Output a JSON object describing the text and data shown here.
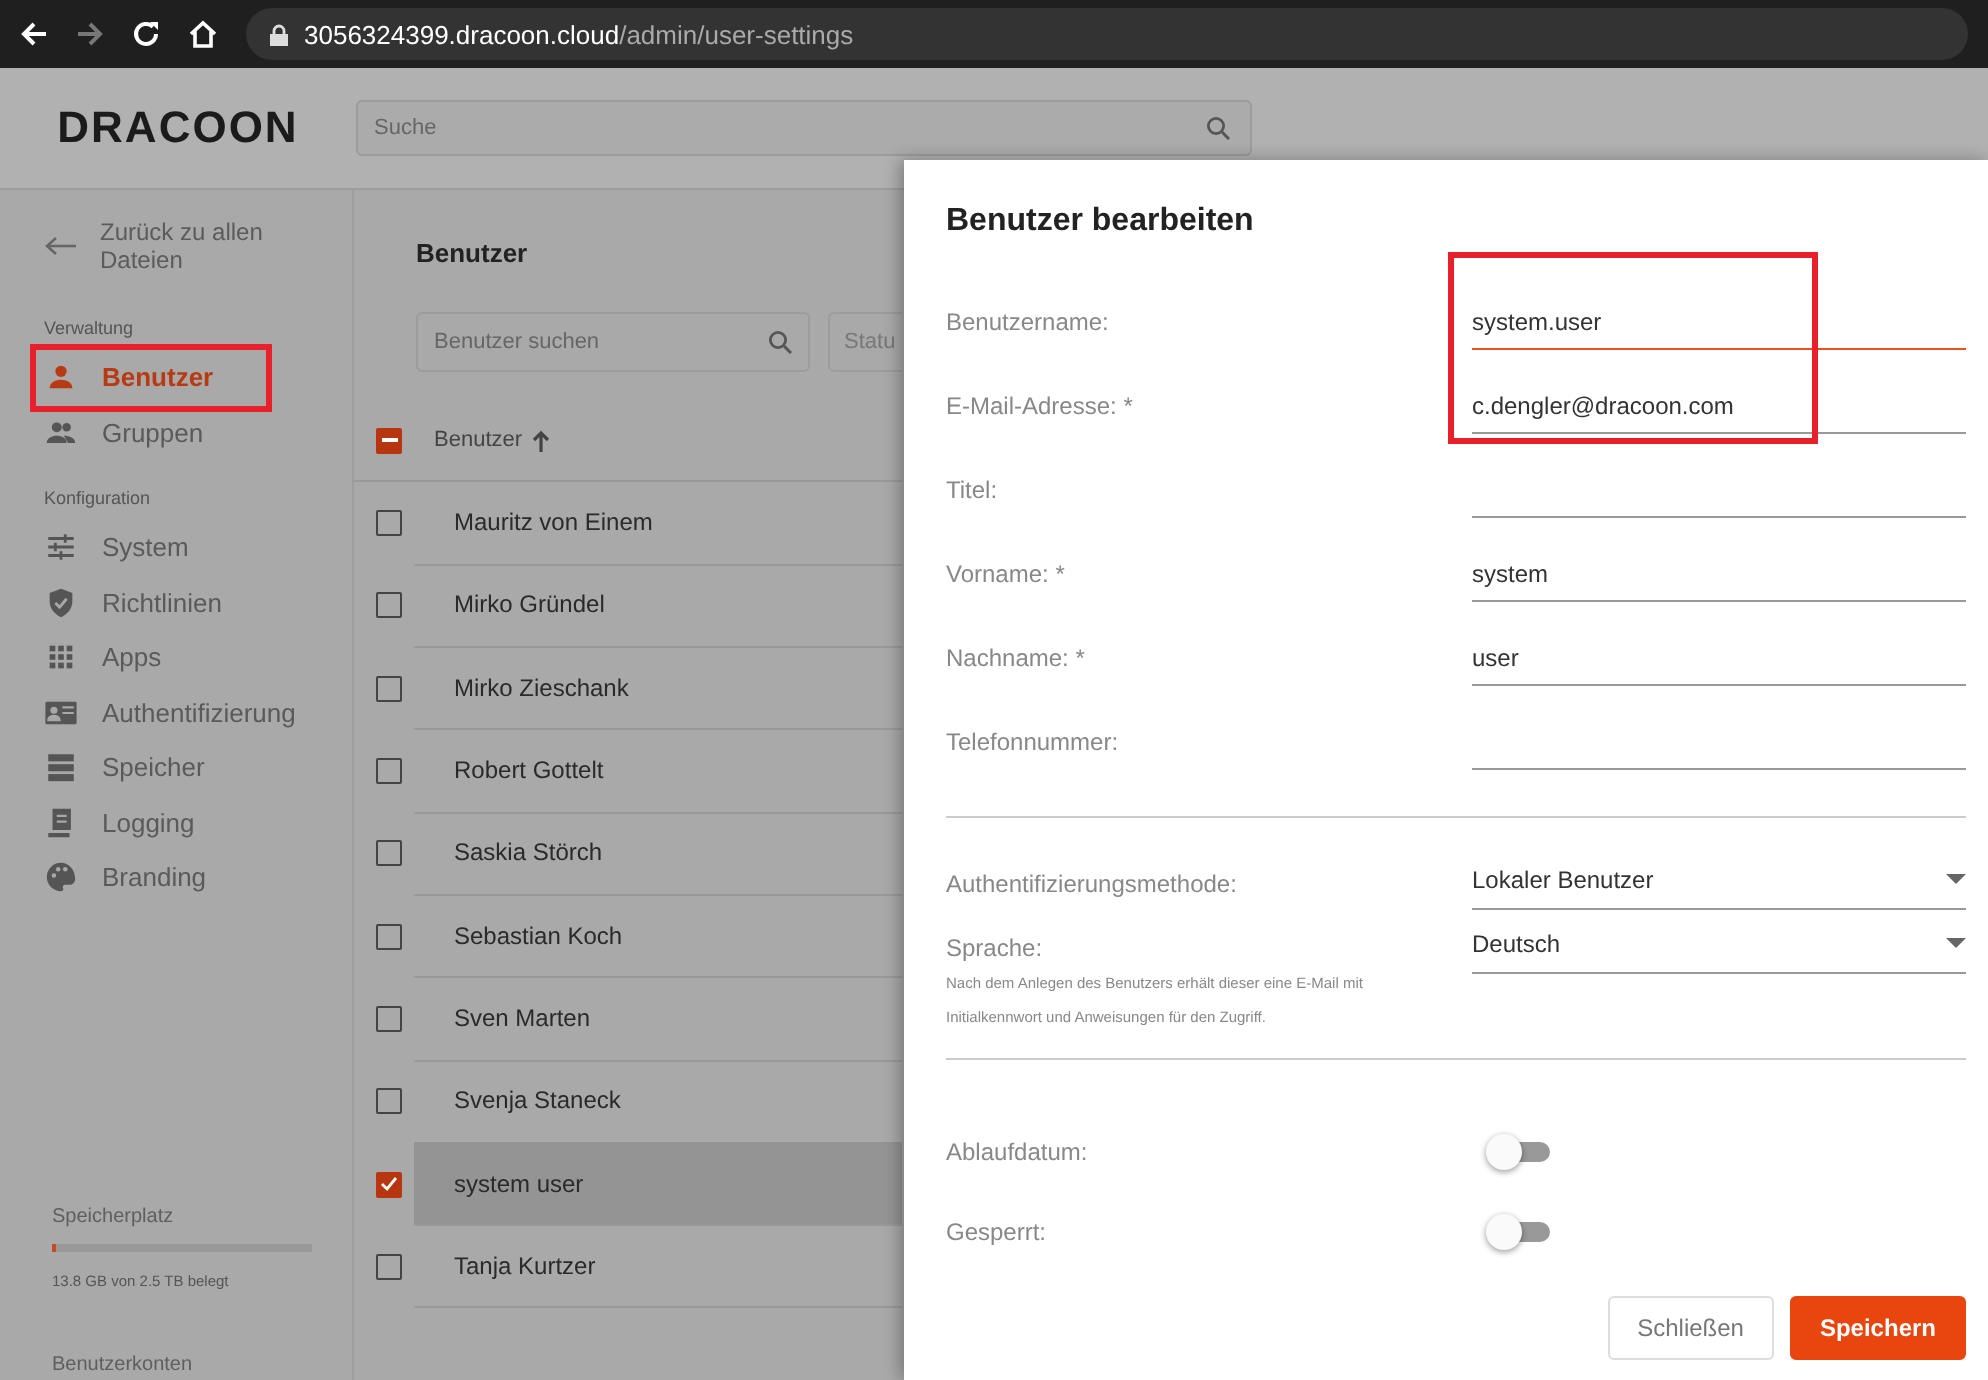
{
  "browser": {
    "url_host": "3056324399.dracoon.cloud",
    "url_path": "/admin/user-settings",
    "forward_disabled": true
  },
  "header": {
    "logo": "DRACOON",
    "search": {
      "placeholder": "Suche"
    }
  },
  "sidebar": {
    "back": "Zurück zu allen Dateien",
    "sections": [
      {
        "title": "Verwaltung",
        "items": [
          {
            "label": "Benutzer",
            "selected": true,
            "highlighted": true
          },
          {
            "label": "Gruppen",
            "selected": false,
            "highlighted": false
          }
        ]
      },
      {
        "title": "Konfiguration",
        "items": [
          {
            "label": "System",
            "selected": false,
            "highlighted": false
          },
          {
            "label": "Richtlinien",
            "selected": false,
            "highlighted": false
          },
          {
            "label": "Apps",
            "selected": false,
            "highlighted": false
          },
          {
            "label": "Authentifizierung",
            "selected": false,
            "highlighted": false
          },
          {
            "label": "Speicher",
            "selected": false,
            "highlighted": false
          },
          {
            "label": "Logging",
            "selected": false,
            "highlighted": false
          },
          {
            "label": "Branding",
            "selected": false,
            "highlighted": false
          }
        ]
      }
    ],
    "storage": {
      "title": "Speicherplatz",
      "level": 0.01,
      "usage": "13.8 GB von 2.5 TB belegt"
    },
    "footer": "Benutzerkonten"
  },
  "users": {
    "title": "Benutzer",
    "search": {
      "placeholder": "Benutzer suchen"
    },
    "status_filter": {
      "placeholder": "Statu"
    },
    "column": "Benutzer",
    "sort_ascending": true,
    "header_checkbox": {
      "indeterminate": true
    },
    "rows": [
      {
        "name": "Mauritz von Einem",
        "checked": false,
        "selected": false
      },
      {
        "name": "Mirko Gründel",
        "checked": false,
        "selected": false
      },
      {
        "name": "Mirko Zieschank",
        "checked": false,
        "selected": false
      },
      {
        "name": "Robert Gottelt",
        "checked": false,
        "selected": false
      },
      {
        "name": "Saskia Störch",
        "checked": false,
        "selected": false
      },
      {
        "name": "Sebastian Koch",
        "checked": false,
        "selected": false
      },
      {
        "name": "Sven Marten",
        "checked": false,
        "selected": false
      },
      {
        "name": "Svenja Staneck",
        "checked": false,
        "selected": false
      },
      {
        "name": "system user",
        "checked": true,
        "selected": true
      },
      {
        "name": "Tanja Kurtzer",
        "checked": false,
        "selected": false
      }
    ]
  },
  "dialog": {
    "title": "Benutzer bearbeiten",
    "highlight_account_fields": true,
    "fields": [
      {
        "label": "Benutzername:",
        "value": "system.user",
        "focused": true
      },
      {
        "label": "E-Mail-Adresse: *",
        "value": "c.dengler@dracoon.com",
        "focused": false
      },
      {
        "label": "Titel:",
        "focused": false
      },
      {
        "label": "Vorname: *",
        "value": "system",
        "focused": false
      },
      {
        "label": "Nachname: *",
        "value": "user",
        "focused": false
      },
      {
        "label": "Telefonnummer:",
        "focused": false
      }
    ],
    "selects": [
      {
        "label": "Authentifizierungsmethode:",
        "value": "Lokaler Benutzer"
      },
      {
        "label": "Sprache:",
        "value": "Deutsch",
        "hint": "Nach dem Anlegen des Benutzers erhält dieser eine E-Mail mit Initialkennwort und Anweisungen für den Zugriff."
      }
    ],
    "toggles": [
      {
        "label": "Ablaufdatum:",
        "on": false
      },
      {
        "label": "Gesperrt:",
        "on": false
      }
    ],
    "buttons": [
      {
        "label": "Schließen",
        "kind": "secondary"
      },
      {
        "label": "Speichern",
        "kind": "primary"
      }
    ]
  }
}
